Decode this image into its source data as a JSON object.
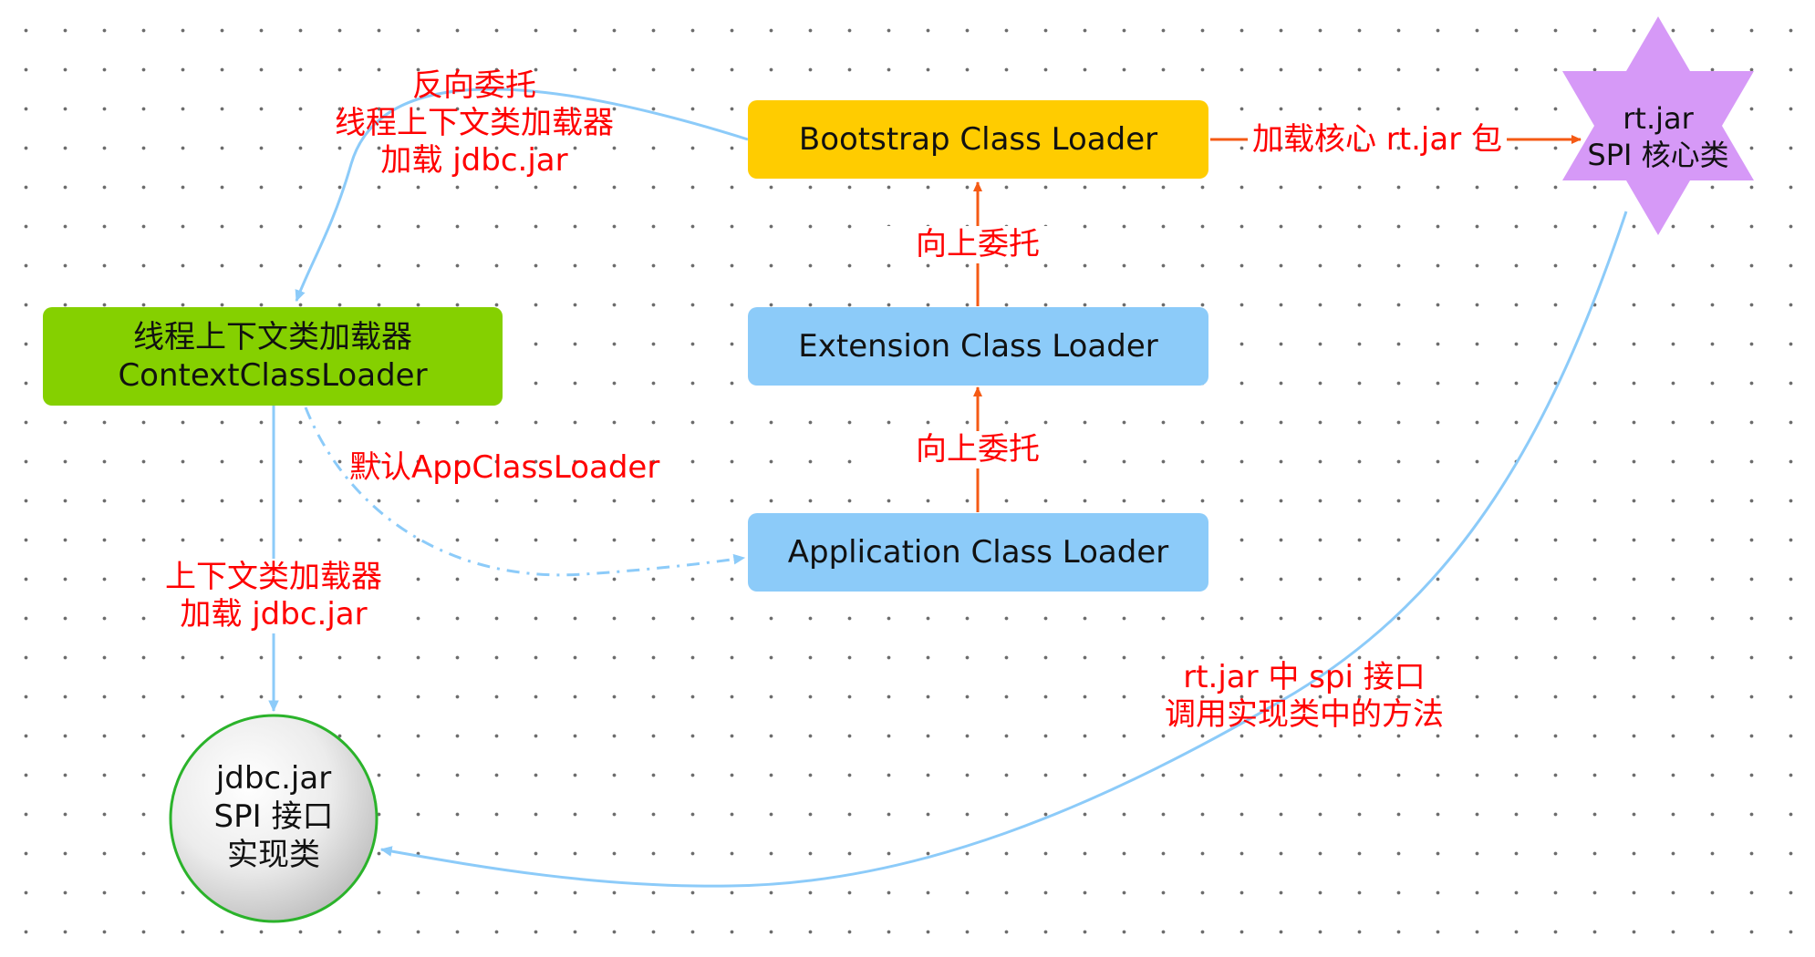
{
  "nodes": {
    "bootstrap": {
      "label": "Bootstrap Class Loader",
      "color": "#ffcc00"
    },
    "extension": {
      "label": "Extension Class Loader",
      "color": "#8ccbf9"
    },
    "application": {
      "label": "Application Class Loader",
      "color": "#8ccbf9"
    },
    "context": {
      "line1": "线程上下文类加载器",
      "line2": "ContextClassLoader",
      "color": "#85d000"
    },
    "rt_jar": {
      "line1": "rt.jar",
      "line2": "SPI 核心类",
      "color": "#d699f7"
    },
    "jdbc": {
      "line1": "jdbc.jar",
      "line2": "SPI 接口",
      "line3": "实现类"
    }
  },
  "edge_labels": {
    "reverse": {
      "line1": "反向委托",
      "line2": "线程上下文类加载器",
      "line3": "加载 jdbc.jar"
    },
    "up_delegate_1": "向上委托",
    "up_delegate_2": "向上委托",
    "load_core": "加载核心 rt.jar 包",
    "default_app": "默认AppClassLoader",
    "context_load": {
      "line1": "上下文类加载器",
      "line2": "加载 jdbc.jar"
    },
    "spi_call": {
      "line1": "rt.jar 中 spi 接口",
      "line2": "调用实现类中的方法"
    }
  },
  "colors": {
    "edge_blue": "#8ccbf9",
    "edge_orange": "#f55a14",
    "label_red": "#ff0000",
    "circle_border": "#2bb32b"
  }
}
